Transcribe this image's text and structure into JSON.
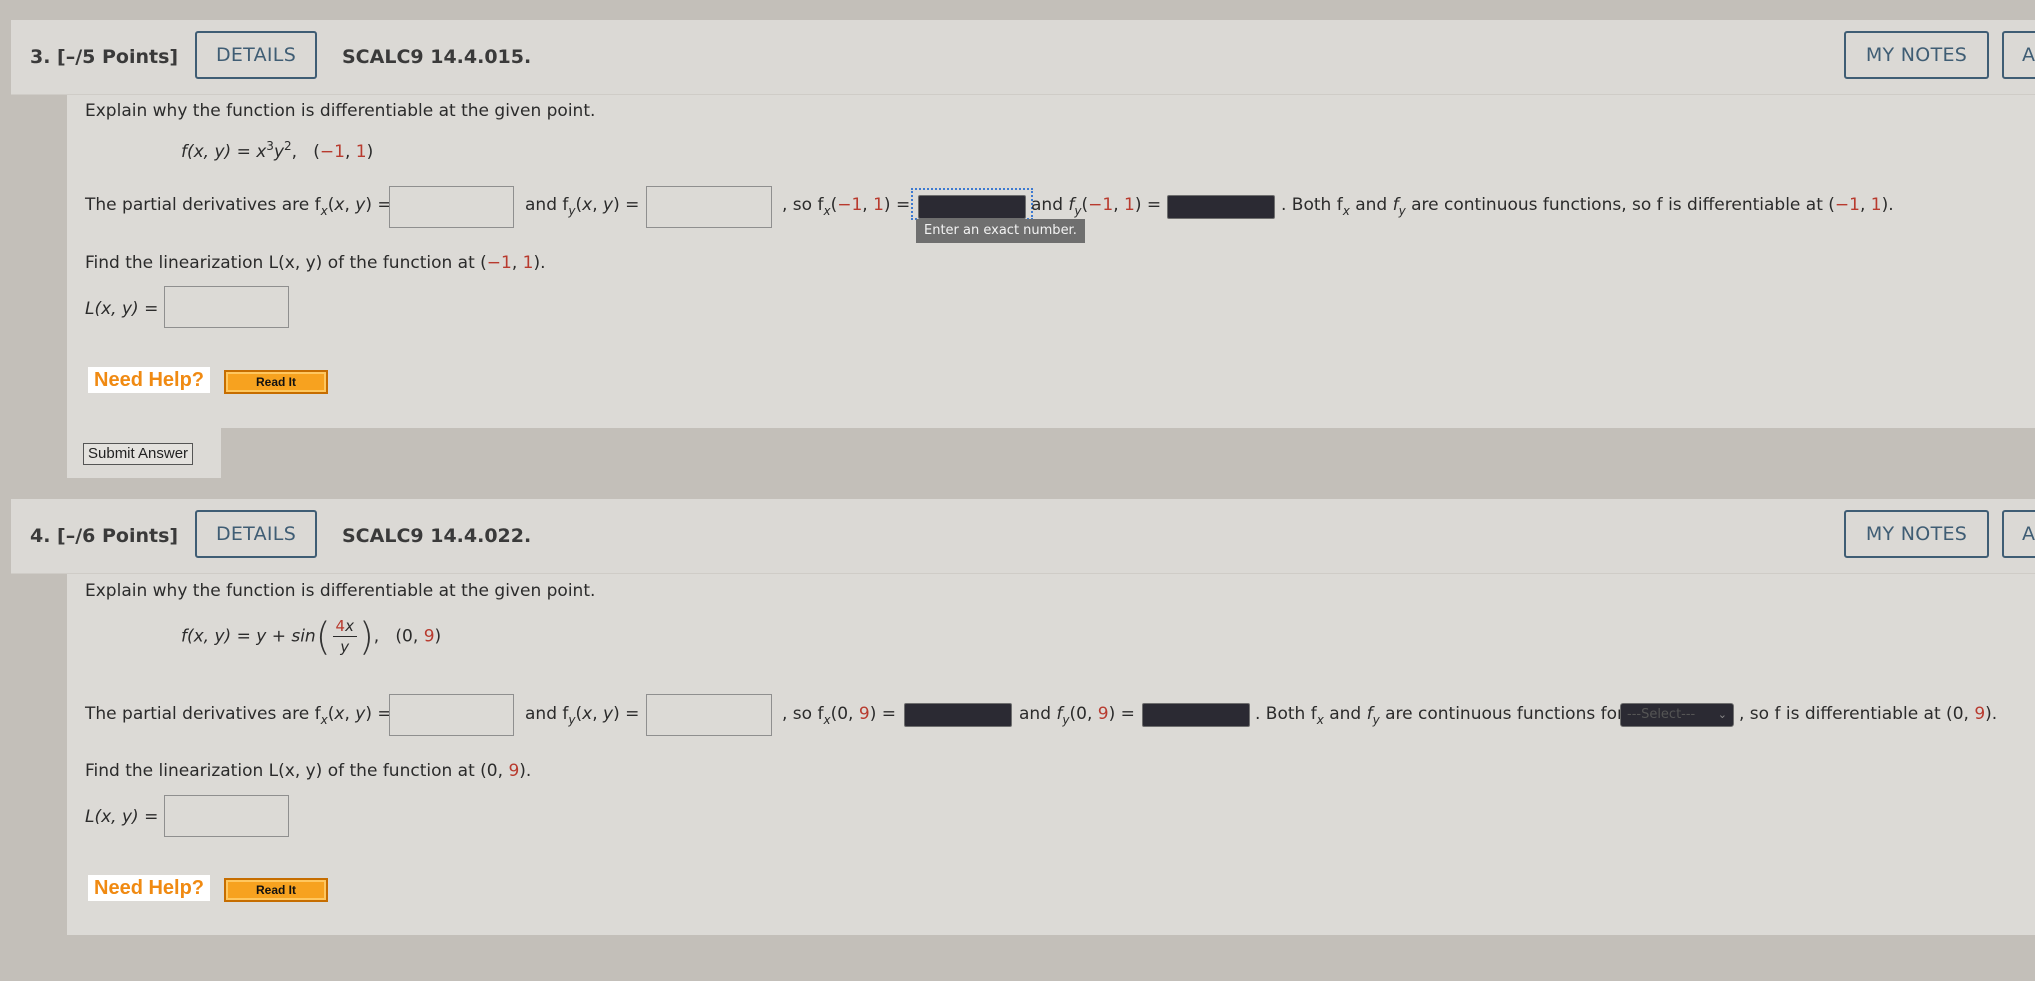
{
  "q3": {
    "number": "3.  [–/5 Points]",
    "details": "DETAILS",
    "code": "SCALC9 14.4.015.",
    "my_notes": "MY NOTES",
    "ask": "A",
    "instruction": "Explain why the function is differentiable at the given point.",
    "func_lhs": "f(x, y) = x",
    "func_exp1": "3",
    "func_mid": "y",
    "func_exp2": "2",
    "func_pt_a": "−1",
    "func_pt_b": "1",
    "partial_intro": "The partial derivatives are f",
    "and_text": "and f",
    "so_text": ", so f",
    "pt_a": "−1",
    "pt_b": "1",
    "both_text": ". Both f",
    "continuous_text": "are continuous functions, so f is differentiable at",
    "tooltip": "Enter an exact number.",
    "linearize_text": "Find the linearization L(x, y) of the function at",
    "L_label": "L(x, y) =",
    "need_help": "Need Help?",
    "read_it": "Read It",
    "submit": "Submit Answer"
  },
  "q4": {
    "number": "4.  [–/6 Points]",
    "details": "DETAILS",
    "code": "SCALC9 14.4.022.",
    "my_notes": "MY NOTES",
    "ask": "A",
    "instruction": "Explain why the function is differentiable at the given point.",
    "func_lhs": "f(x, y) = y + sin",
    "frac_num_coef": "4",
    "frac_num_var": "x",
    "frac_den": "y",
    "func_pt_a": "0",
    "func_pt_b": "9",
    "partial_intro": "The partial derivatives are f",
    "and_text": "and f",
    "so_text": ", so f",
    "pt_a": "0",
    "pt_b": "9",
    "both_text": ". Both f",
    "continuous_text": "are continuous functions for",
    "select_placeholder": "---Select---",
    "differentiable_text": ", so f is differentiable at",
    "linearize_text": "Find the linearization L(x, y) of the function at",
    "L_label": "L(x, y) =",
    "need_help": "Need Help?",
    "read_it": "Read It"
  },
  "colors": {
    "page_bg": "#c3bfb9",
    "panel_bg": "#dcdad6",
    "accent_button": "#3f5d74",
    "point_red": "#b83a2e",
    "need_help_orange": "#f08a12"
  }
}
